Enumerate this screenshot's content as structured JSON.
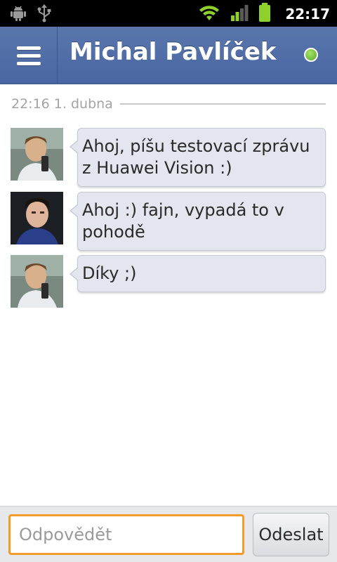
{
  "status_bar": {
    "time": "22:17",
    "icons": [
      "android-debug-icon",
      "usb-icon",
      "wifi-icon",
      "signal-icon",
      "battery-icon"
    ]
  },
  "header": {
    "title": "Michal Pavlíček",
    "menu_icon": "hamburger-menu-icon",
    "status_icon": "online-status-icon",
    "colors": {
      "bar": "#4f6ca6",
      "online": "#6cc23a"
    }
  },
  "conversation": {
    "timestamp": "22:16 1. dubna",
    "messages": [
      {
        "sender": "self",
        "text_line1": "Ahoj, píšu testovací zprávu",
        "text_line2": "z Huawei Vision :)"
      },
      {
        "sender": "contact",
        "text_line1": "Ahoj :)  fajn, vypadá to v",
        "text_line2": "pohodě"
      },
      {
        "sender": "self",
        "text_line1": "Díky ;)"
      }
    ]
  },
  "composer": {
    "placeholder": "Odpovědět",
    "send_label": "Odeslat",
    "colors": {
      "focus_border": "#f39a2b"
    }
  }
}
